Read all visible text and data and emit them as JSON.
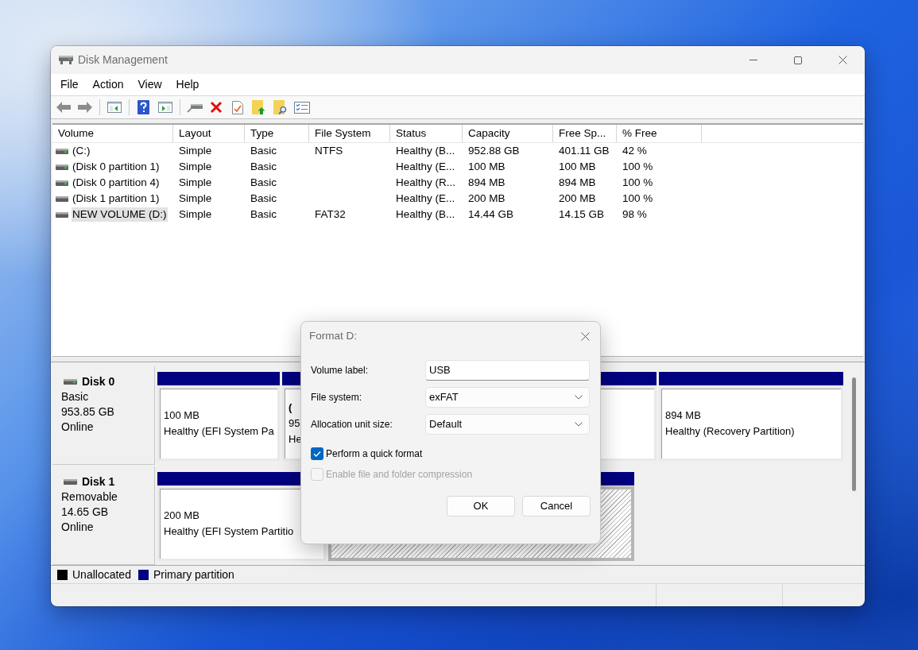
{
  "window": {
    "title": "Disk Management"
  },
  "menu": [
    "File",
    "Action",
    "View",
    "Help"
  ],
  "volume_list": {
    "columns": [
      "Volume",
      "Layout",
      "Type",
      "File System",
      "Status",
      "Capacity",
      "Free Sp...",
      "% Free"
    ],
    "rows": [
      {
        "kind": "fixed",
        "volume": "(C:)",
        "layout": "Simple",
        "type": "Basic",
        "file_system": "NTFS",
        "status": "Healthy (B...",
        "capacity": "952.88 GB",
        "column_7": "401.11 GB",
        "percent_free": "42 %",
        "selected": false
      },
      {
        "kind": "fixed",
        "volume": "(Disk 0 partition 1)",
        "layout": "Simple",
        "type": "Basic",
        "status": "Healthy (E...",
        "capacity": "100 MB",
        "column_7": "100 MB",
        "percent_free": "100 %",
        "selected": false
      },
      {
        "kind": "fixed",
        "volume": "(Disk 0 partition 4)",
        "layout": "Simple",
        "type": "Basic",
        "status": "Healthy (R...",
        "capacity": "894 MB",
        "column_7": "894 MB",
        "percent_free": "100 %",
        "selected": false
      },
      {
        "kind": "removable",
        "volume": "(Disk 1 partition 1)",
        "layout": "Simple",
        "type": "Basic",
        "status": "Healthy (E...",
        "capacity": "200 MB",
        "column_7": "200 MB",
        "percent_free": "100 %",
        "selected": false
      },
      {
        "kind": "removable",
        "volume": "NEW VOLUME (D:)",
        "layout": "Simple",
        "type": "Basic",
        "file_system": "FAT32",
        "status": "Healthy (B...",
        "capacity": "14.44 GB",
        "column_7": "14.15 GB",
        "percent_free": "98 %",
        "selected": true
      }
    ]
  },
  "disks": [
    {
      "kind": "fixed",
      "name": "Disk 0",
      "type": "Basic",
      "size": "953.85 GB",
      "status": "Online",
      "partitions": [
        {
          "kind": "primary",
          "selected": false,
          "size": "100 MB",
          "status": "Healthy (EFI System Pa"
        },
        {
          "kind": "primary",
          "selected": false,
          "label": "(",
          "size": "95",
          "status": "He"
        },
        {
          "kind": "primary",
          "selected": false
        },
        {
          "kind": "primary",
          "selected": false,
          "size": "894 MB",
          "status": "Healthy (Recovery Partition)"
        }
      ]
    },
    {
      "kind": "removable",
      "name": "Disk 1",
      "type": "Removable",
      "size": "14.65 GB",
      "status": "Online",
      "partitions": [
        {
          "kind": "primary",
          "selected": false,
          "size": "200 MB",
          "status": "Healthy (EFI System Partitio"
        },
        {
          "kind": "primary",
          "selected": true
        }
      ]
    }
  ],
  "legend": [
    {
      "label": "Unallocated",
      "color": "#000000"
    },
    {
      "label": "Primary partition",
      "color": "#000080"
    }
  ],
  "format_dialog": {
    "title": "Format D:",
    "fields": [
      {
        "kind": "text",
        "label": "Volume label:",
        "value": "USB"
      },
      {
        "kind": "dropdown",
        "label": "File system:",
        "value": "exFAT"
      },
      {
        "kind": "dropdown",
        "label": "Allocation unit size:",
        "value": "Default"
      }
    ],
    "options": [
      {
        "label": "Perform a quick format",
        "checked": true,
        "disabled": false
      },
      {
        "label": "Enable file and folder compression",
        "checked": false,
        "disabled": true
      }
    ],
    "buttons": [
      "OK",
      "Cancel"
    ]
  }
}
